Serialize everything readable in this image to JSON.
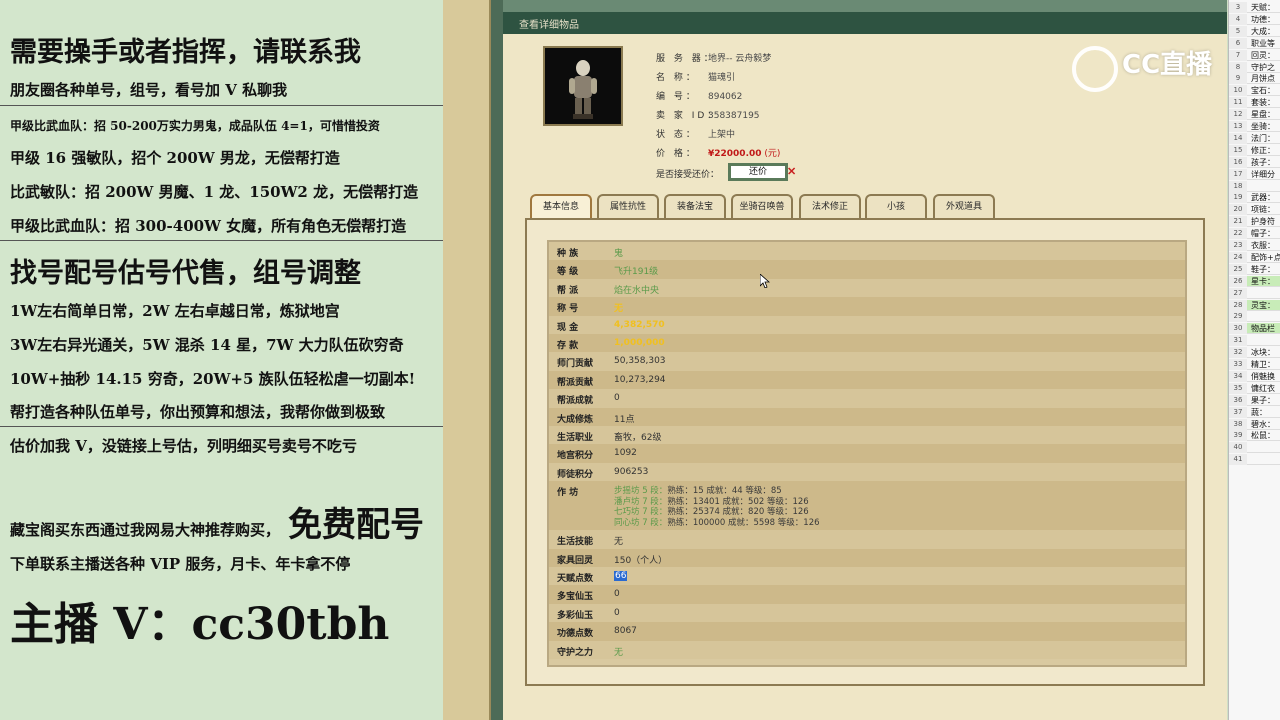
{
  "promo": {
    "l1": "需要操手或者指挥，请联系我",
    "l2": "朋友圈各种单号，组号，看号加 V 私聊我",
    "l3": "甲级比武血队：招 50-200万实力男鬼，成品队伍 4=1，可惜惜投资",
    "l4": "甲级 16 强敏队，招个 200W 男龙，无偿帮打造",
    "l5": "比武敏队：招 200W 男魔、1 龙、150W2 龙，无偿帮打造",
    "l6": "甲级比武血队：招 300-400W 女魔，所有角色无偿帮打造",
    "l7": "找号配号估号代售，组号调整",
    "l8": "1W左右简单日常，2W 左右卓越日常，炼狱地宫",
    "l9": "3W左右异光通关，5W 混杀 14 星，7W 大力队伍砍穷奇",
    "l10": "10W+抽秒 14.15 穷奇，20W+5 族队伍轻松虐一切副本!",
    "l11": "帮打造各种队伍单号，你出预算和想法，我帮你做到极致",
    "l12": "估价加我 V，没链接上号估，列明细买号卖号不吃亏",
    "l13a": "藏宝阁买东西通过我网易大神推荐购买，",
    "l13b": "免费配号",
    "l14": "下单联系主播送各种 VIP 服务，月卡、年卡拿不停",
    "l15": "主播 V：cc30tbh"
  },
  "window": {
    "title": "查看详细物品",
    "server_label": "服 务 器：",
    "server": "地界-- 云舟毅梦",
    "name_label": "名     称：",
    "name": "猫魂引",
    "id_label": "编     号：",
    "id": "894062",
    "seller_label": "卖 家 ID：",
    "seller": "358387195",
    "status_label": "状     态：",
    "status": "上架中",
    "price_label": "价     格：",
    "price": "¥22000.00",
    "price_unit": "(元)",
    "bargain_label": "是否接受还价：",
    "bargain_button": "还价",
    "bargain_x": "✕"
  },
  "tabs": [
    "基本信息",
    "属性抗性",
    "装备法宝",
    "坐骑召唤兽",
    "法术修正",
    "小孩",
    "外观道具"
  ],
  "attributes": [
    {
      "k": "种    族",
      "v": "鬼",
      "style": "green"
    },
    {
      "k": "等    级",
      "v": "飞升191级",
      "style": "green"
    },
    {
      "k": "帮    派",
      "v": "焰在水中央",
      "style": "green"
    },
    {
      "k": "称    号",
      "v": "无",
      "style": "yellow"
    },
    {
      "k": "现    金",
      "v": "4,382,570",
      "style": "yellow"
    },
    {
      "k": "存    款",
      "v": "1,000,000",
      "style": "yellow"
    },
    {
      "k": "师门贡献",
      "v": "50,358,303",
      "style": ""
    },
    {
      "k": "帮派贡献",
      "v": "10,273,294",
      "style": ""
    },
    {
      "k": "帮派成就",
      "v": "0",
      "style": ""
    },
    {
      "k": "大成修炼",
      "v": "11点",
      "style": ""
    },
    {
      "k": "生活职业",
      "v": "畜牧，62级",
      "style": ""
    },
    {
      "k": "地宫积分",
      "v": "1092",
      "style": ""
    },
    {
      "k": "师徒积分",
      "v": "906253",
      "style": ""
    }
  ],
  "workshop": {
    "label": "作    坊",
    "lines": [
      {
        "nm": "步摇坊 5 段：",
        "rest": "熟练：15   成就：44   等级：85"
      },
      {
        "nm": "潘卢坊 7 段：",
        "rest": "熟练：13401   成就：502   等级：126"
      },
      {
        "nm": "七巧坊 7 段：",
        "rest": "熟练：25374   成就：820   等级：126"
      },
      {
        "nm": "同心坊 7 段：",
        "rest": "熟练：100000   成就：5598   等级：126"
      }
    ]
  },
  "attributes2": [
    {
      "k": "生活技能",
      "v": "无",
      "style": ""
    },
    {
      "k": "家具回灵",
      "v": "150（个人）",
      "style": ""
    },
    {
      "k": "天赋点数",
      "v": "66",
      "style": "sel"
    },
    {
      "k": "多宝仙玉",
      "v": "0",
      "style": ""
    },
    {
      "k": "多彩仙玉",
      "v": "0",
      "style": ""
    },
    {
      "k": "功德点数",
      "v": "8067",
      "style": ""
    },
    {
      "k": "守护之力",
      "v": "无",
      "style": "green"
    }
  ],
  "sheet": [
    {
      "n": "3",
      "t": "天赋："
    },
    {
      "n": "4",
      "t": "功德："
    },
    {
      "n": "5",
      "t": "大成："
    },
    {
      "n": "6",
      "t": "职业等"
    },
    {
      "n": "7",
      "t": "回灵："
    },
    {
      "n": "8",
      "t": "守护之"
    },
    {
      "n": "9",
      "t": "月饼点"
    },
    {
      "n": "10",
      "t": "宝石："
    },
    {
      "n": "11",
      "t": "套装："
    },
    {
      "n": "12",
      "t": "星盘："
    },
    {
      "n": "13",
      "t": "坐骑："
    },
    {
      "n": "14",
      "t": "法门："
    },
    {
      "n": "15",
      "t": "修正："
    },
    {
      "n": "16",
      "t": "孩子："
    },
    {
      "n": "17",
      "t": "详细分"
    },
    {
      "n": "18",
      "t": ""
    },
    {
      "n": "19",
      "t": "武器："
    },
    {
      "n": "20",
      "t": "项链："
    },
    {
      "n": "21",
      "t": "护身符"
    },
    {
      "n": "22",
      "t": "帽子："
    },
    {
      "n": "23",
      "t": "衣服："
    },
    {
      "n": "24",
      "t": "配饰+点"
    },
    {
      "n": "25",
      "t": "鞋子："
    },
    {
      "n": "26",
      "t": "星卡：",
      "hl": true
    },
    {
      "n": "27",
      "t": ""
    },
    {
      "n": "28",
      "t": "灵宝：",
      "hl": true
    },
    {
      "n": "29",
      "t": ""
    },
    {
      "n": "30",
      "t": "物品栏",
      "hl": true
    },
    {
      "n": "31",
      "t": ""
    },
    {
      "n": "32",
      "t": "冰块："
    },
    {
      "n": "33",
      "t": "精卫："
    },
    {
      "n": "34",
      "t": "俏魅换"
    },
    {
      "n": "35",
      "t": "慵红衣"
    },
    {
      "n": "36",
      "t": "果子："
    },
    {
      "n": "37",
      "t": "蔬："
    },
    {
      "n": "38",
      "t": "碧水："
    },
    {
      "n": "39",
      "t": "松鼠："
    },
    {
      "n": "40",
      "t": ""
    },
    {
      "n": "41",
      "t": ""
    }
  ],
  "watermark": "CC直播"
}
